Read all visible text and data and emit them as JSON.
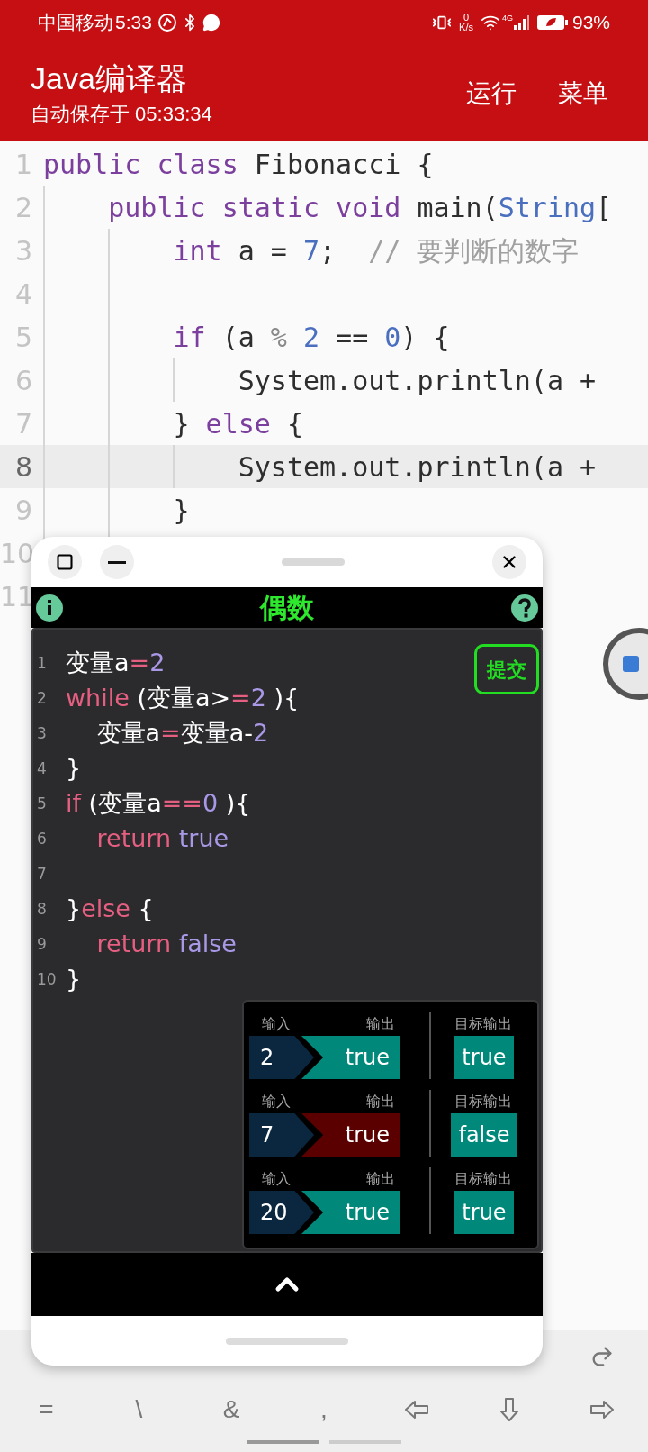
{
  "status_bar": {
    "carrier": "中国移动",
    "time": "5:33",
    "net_speed_value": "0",
    "net_speed_unit": "K/s",
    "network": "4G",
    "battery": "93%"
  },
  "header": {
    "title": "Java编译器",
    "subtitle": "自动保存于 05:33:34",
    "actions": [
      "运行",
      "菜单"
    ]
  },
  "editor": {
    "lines": [
      {
        "number": "1",
        "current": false,
        "tokens": [
          {
            "kind": "keyword",
            "text": "public class"
          },
          {
            "kind": "plain",
            "text": " Fibonacci {"
          }
        ]
      },
      {
        "number": "2",
        "current": false,
        "tokens": [
          {
            "kind": "keyword",
            "text": "    public static void"
          },
          {
            "kind": "plain",
            "text": " main("
          },
          {
            "kind": "type",
            "text": "String"
          },
          {
            "kind": "plain",
            "text": "["
          }
        ]
      },
      {
        "number": "3",
        "current": false,
        "tokens": [
          {
            "kind": "keyword",
            "text": "        int"
          },
          {
            "kind": "plain",
            "text": " a = "
          },
          {
            "kind": "number",
            "text": "7"
          },
          {
            "kind": "plain",
            "text": ";"
          },
          {
            "kind": "comment",
            "text": "  // 要判断的数字"
          }
        ]
      },
      {
        "number": "4",
        "current": false
      },
      {
        "number": "5",
        "current": false,
        "tokens": [
          {
            "kind": "keyword",
            "text": "        if"
          },
          {
            "kind": "plain",
            "text": " (a "
          },
          {
            "kind": "operator",
            "text": "%"
          },
          {
            "kind": "number",
            "text": " 2"
          },
          {
            "kind": "plain",
            "text": " == "
          },
          {
            "kind": "number",
            "text": "0"
          },
          {
            "kind": "plain",
            "text": ") {"
          }
        ]
      },
      {
        "number": "6",
        "current": false,
        "tokens": [
          {
            "kind": "plain",
            "text": "            System.out.println(a +"
          }
        ]
      },
      {
        "number": "7",
        "current": false,
        "tokens": [
          {
            "kind": "plain",
            "text": "        } "
          },
          {
            "kind": "keyword",
            "text": "else"
          },
          {
            "kind": "plain",
            "text": " {"
          }
        ]
      },
      {
        "number": "8",
        "current": true,
        "tokens": [
          {
            "kind": "plain",
            "text": "            System.out.println(a +"
          }
        ]
      },
      {
        "number": "9",
        "current": false,
        "tokens": [
          {
            "kind": "plain",
            "text": "        }"
          }
        ]
      },
      {
        "number": "10",
        "current": false
      },
      {
        "number": "11",
        "current": false
      }
    ]
  },
  "popup": {
    "title": "偶数",
    "submit": "提交",
    "code": [
      {
        "number": "1",
        "tokens": [
          {
            "kind": "plain",
            "text": "变量a"
          },
          {
            "kind": "operator",
            "text": "="
          },
          {
            "kind": "literal",
            "text": "2"
          }
        ]
      },
      {
        "number": "2",
        "tokens": [
          {
            "kind": "keyword",
            "text": "while"
          },
          {
            "kind": "plain",
            "text": " (变量a>"
          },
          {
            "kind": "operator",
            "text": "="
          },
          {
            "kind": "literal",
            "text": "2"
          },
          {
            "kind": "plain",
            "text": " ){"
          }
        ]
      },
      {
        "number": "3",
        "tokens": [
          {
            "kind": "plain",
            "text": "    变量a"
          },
          {
            "kind": "operator",
            "text": "="
          },
          {
            "kind": "plain",
            "text": "变量a-"
          },
          {
            "kind": "literal",
            "text": "2"
          }
        ]
      },
      {
        "number": "4",
        "tokens": [
          {
            "kind": "plain",
            "text": "}"
          }
        ]
      },
      {
        "number": "5",
        "tokens": [
          {
            "kind": "keyword",
            "text": "if"
          },
          {
            "kind": "plain",
            "text": " (变量a"
          },
          {
            "kind": "operator",
            "text": "=="
          },
          {
            "kind": "literal",
            "text": "0"
          },
          {
            "kind": "plain",
            "text": " ){"
          }
        ]
      },
      {
        "number": "6",
        "tokens": [
          {
            "kind": "keyword",
            "text": "    return"
          },
          {
            "kind": "literal",
            "text": " true"
          }
        ]
      },
      {
        "number": "7"
      },
      {
        "number": "8",
        "tokens": [
          {
            "kind": "plain",
            "text": "}"
          },
          {
            "kind": "keyword",
            "text": "else"
          },
          {
            "kind": "plain",
            "text": " {"
          }
        ]
      },
      {
        "number": "9",
        "tokens": [
          {
            "kind": "keyword",
            "text": "    return"
          },
          {
            "kind": "literal",
            "text": " false"
          }
        ]
      },
      {
        "number": "10",
        "tokens": [
          {
            "kind": "plain",
            "text": "}"
          }
        ]
      }
    ],
    "tests": [
      {
        "input_label": "输入",
        "input": "2",
        "output_label": "输出",
        "output": "true",
        "correct": true,
        "target_label": "目标输出",
        "target": "true"
      },
      {
        "input_label": "输入",
        "input": "7",
        "output_label": "输出",
        "output": "true",
        "correct": false,
        "target_label": "目标输出",
        "target": "false"
      },
      {
        "input_label": "输入",
        "input": "20",
        "output_label": "输出",
        "output": "true",
        "correct": true,
        "target_label": "目标输出",
        "target": "true"
      }
    ]
  },
  "keyboard": {
    "keys": [
      "=",
      "\\",
      "&",
      ","
    ]
  }
}
